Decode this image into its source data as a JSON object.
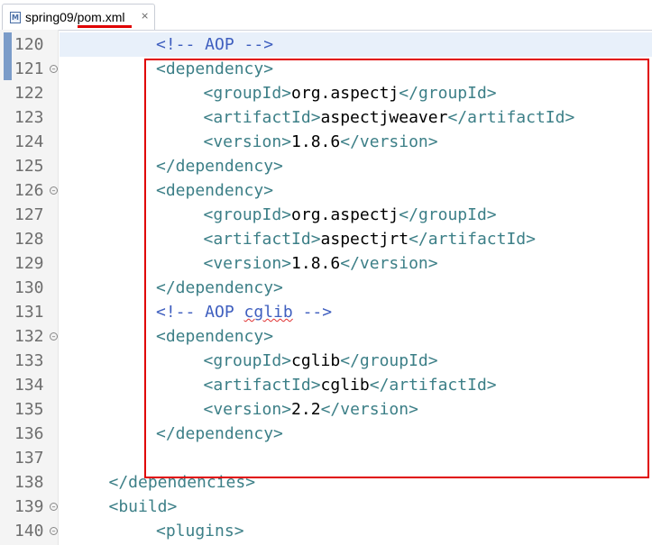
{
  "tab": {
    "title": "spring09/pom.xml",
    "close_icon": "close-icon",
    "file_icon": "xml-file-icon",
    "icon_letter": "M"
  },
  "colors": {
    "highlight_box": "#e00000",
    "tag": "#3c7f87",
    "comment": "#3f5fbf",
    "text": "#000000"
  },
  "lines": [
    {
      "num": "120",
      "fold": false,
      "indent": 2,
      "parts": [
        [
          "cmt",
          "<!-- AOP -->"
        ]
      ]
    },
    {
      "num": "121",
      "fold": true,
      "indent": 2,
      "parts": [
        [
          "tag",
          "<dependency>"
        ]
      ]
    },
    {
      "num": "122",
      "fold": false,
      "indent": 3,
      "parts": [
        [
          "tag",
          "<groupId>"
        ],
        [
          "txt",
          "org.aspectj"
        ],
        [
          "tag",
          "</groupId>"
        ]
      ]
    },
    {
      "num": "123",
      "fold": false,
      "indent": 3,
      "parts": [
        [
          "tag",
          "<artifactId>"
        ],
        [
          "txt",
          "aspectjweaver"
        ],
        [
          "tag",
          "</artifactId>"
        ]
      ]
    },
    {
      "num": "124",
      "fold": false,
      "indent": 3,
      "parts": [
        [
          "tag",
          "<version>"
        ],
        [
          "txt",
          "1.8.6"
        ],
        [
          "tag",
          "</version>"
        ]
      ]
    },
    {
      "num": "125",
      "fold": false,
      "indent": 2,
      "parts": [
        [
          "tag",
          "</dependency>"
        ]
      ]
    },
    {
      "num": "126",
      "fold": true,
      "indent": 2,
      "parts": [
        [
          "tag",
          "<dependency>"
        ]
      ]
    },
    {
      "num": "127",
      "fold": false,
      "indent": 3,
      "parts": [
        [
          "tag",
          "<groupId>"
        ],
        [
          "txt",
          "org.aspectj"
        ],
        [
          "tag",
          "</groupId>"
        ]
      ]
    },
    {
      "num": "128",
      "fold": false,
      "indent": 3,
      "parts": [
        [
          "tag",
          "<artifactId>"
        ],
        [
          "txt",
          "aspectjrt"
        ],
        [
          "tag",
          "</artifactId>"
        ]
      ]
    },
    {
      "num": "129",
      "fold": false,
      "indent": 3,
      "parts": [
        [
          "tag",
          "<version>"
        ],
        [
          "txt",
          "1.8.6"
        ],
        [
          "tag",
          "</version>"
        ]
      ]
    },
    {
      "num": "130",
      "fold": false,
      "indent": 2,
      "parts": [
        [
          "tag",
          "</dependency>"
        ]
      ]
    },
    {
      "num": "131",
      "fold": false,
      "indent": 2,
      "parts": [
        [
          "cmt",
          "<!-- AOP "
        ],
        [
          "cmt-sq",
          "cglib"
        ],
        [
          "cmt",
          " -->"
        ]
      ]
    },
    {
      "num": "132",
      "fold": true,
      "indent": 2,
      "parts": [
        [
          "tag",
          "<dependency>"
        ]
      ]
    },
    {
      "num": "133",
      "fold": false,
      "indent": 3,
      "parts": [
        [
          "tag",
          "<groupId>"
        ],
        [
          "txt",
          "cglib"
        ],
        [
          "tag",
          "</groupId>"
        ]
      ]
    },
    {
      "num": "134",
      "fold": false,
      "indent": 3,
      "parts": [
        [
          "tag",
          "<artifactId>"
        ],
        [
          "txt",
          "cglib"
        ],
        [
          "tag",
          "</artifactId>"
        ]
      ]
    },
    {
      "num": "135",
      "fold": false,
      "indent": 3,
      "parts": [
        [
          "tag",
          "<version>"
        ],
        [
          "txt",
          "2.2"
        ],
        [
          "tag",
          "</version>"
        ]
      ]
    },
    {
      "num": "136",
      "fold": false,
      "indent": 2,
      "parts": [
        [
          "tag",
          "</dependency>"
        ]
      ]
    },
    {
      "num": "137",
      "fold": false,
      "indent": 0,
      "parts": []
    },
    {
      "num": "138",
      "fold": false,
      "indent": 1,
      "parts": [
        [
          "tag",
          "</dependencies>"
        ]
      ]
    },
    {
      "num": "139",
      "fold": true,
      "indent": 1,
      "parts": [
        [
          "tag",
          "<build>"
        ]
      ]
    },
    {
      "num": "140",
      "fold": true,
      "indent": 2,
      "parts": [
        [
          "tag",
          "<plugins>"
        ]
      ]
    }
  ]
}
